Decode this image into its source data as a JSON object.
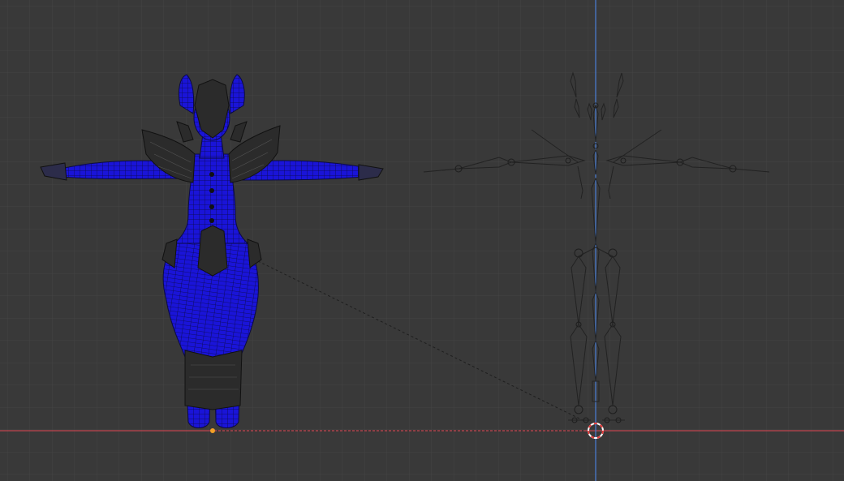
{
  "viewport": {
    "view": "front-orthographic",
    "background_color": "#393939",
    "grid_color": "#464646",
    "grid_major_color": "#4e4e4e",
    "x_axis_color": "#c0454f",
    "z_axis_color": "#4a7fd6"
  },
  "objects": {
    "mesh": {
      "name": "character-mesh",
      "display": "wireframe-overlay",
      "fill_color": "#1a14d8",
      "wire_color": "#0a0a3a",
      "accessory_color": "#2a2a2a",
      "selected": true
    },
    "armature": {
      "name": "armature",
      "display": "octahedral-bones",
      "bone_color": "#222222",
      "selected": false
    },
    "relationship_line": {
      "style": "dashed",
      "color": "#1e1e1e"
    },
    "mesh_origin": {
      "color": "#f2a027",
      "icon": "origin-dot-icon"
    },
    "cursor_3d": {
      "icon": "3d-cursor-icon",
      "ring_colors": [
        "#e63c3c",
        "#ffffff"
      ]
    }
  }
}
